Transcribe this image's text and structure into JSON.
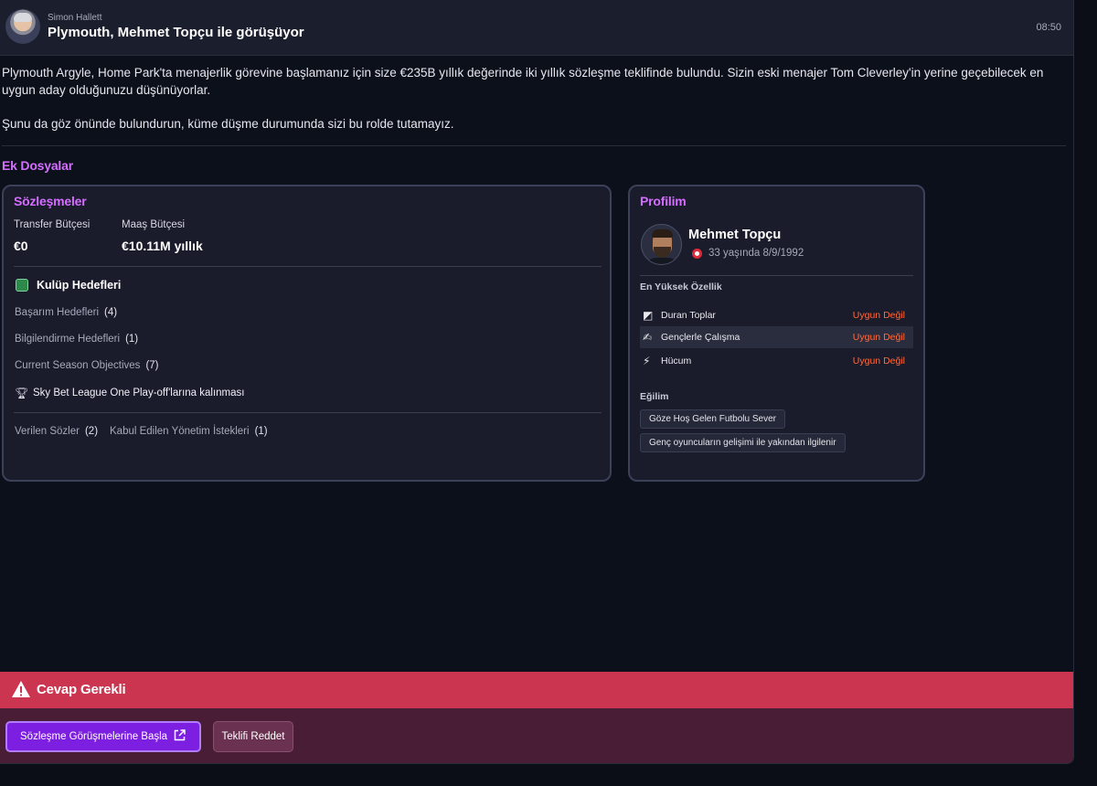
{
  "header": {
    "sender": "Simon Hallett",
    "subject": "Plymouth, Mehmet Topçu ile görüşüyor",
    "time": "08:50"
  },
  "message": {
    "paragraphs": [
      "Plymouth Argyle, Home Park'ta menajerlik görevine başlamanız için size €235B yıllık değerinde iki yıllık sözleşme teklifinde bulundu. Sizin eski menajer Tom Cleverley'in yerine geçebilecek en uygun aday olduğunuzu düşünüyorlar.",
      "Şunu da göz önünde bulundurun, küme düşme durumunda sizi bu rolde tutamayız."
    ]
  },
  "attachments": {
    "title": "Ek Dosyalar",
    "contracts": {
      "title": "Sözleşmeler",
      "transfer_budget_label": "Transfer Bütçesi",
      "transfer_budget_value": "€0",
      "wage_budget_label": "Maaş Bütçesi",
      "wage_budget_value": "€10.11M yıllık",
      "club_objectives_title": "Kulüp Hedefleri",
      "objective_rows": [
        {
          "label": "Başarım Hedefleri",
          "count": "(4)"
        },
        {
          "label": "Bilgilendirme Hedefleri",
          "count": "(1)"
        },
        {
          "label": "Current Season Objectives",
          "count": "(7)"
        }
      ],
      "trophy_objective": "Sky Bet League One Play-off'larına kalınması",
      "promises_label": "Verilen Sözler",
      "promises_count": "(2)",
      "requests_label": "Kabul Edilen Yönetim İstekleri",
      "requests_count": "(1)"
    },
    "profile": {
      "title": "Profilim",
      "name": "Mehmet Topçu",
      "age_dob": "33 yaşında 8/9/1992",
      "top_attributes_title": "En Yüksek Özellik",
      "attributes": [
        {
          "name": "Duran Toplar",
          "status": "Uygun Değil",
          "icon": "set-pieces-icon"
        },
        {
          "name": "Gençlerle Çalışma",
          "status": "Uygun Değil",
          "icon": "youth-icon"
        },
        {
          "name": "Hücum",
          "status": "Uygun Değil",
          "icon": "attack-icon"
        }
      ],
      "tendencies_title": "Eğilim",
      "tendencies": [
        "Göze Hoş Gelen Futbolu Sever",
        "Genç oyuncuların gelişimi ile yakından ilgilenir"
      ],
      "status_color": "#ff6a3d"
    }
  },
  "response": {
    "alert_text": "Cevap Gerekli",
    "alert_color": "#cc3550",
    "primary_button": "Sözleşme Görüşmelerine Başla",
    "secondary_button": "Teklifi Reddet"
  }
}
